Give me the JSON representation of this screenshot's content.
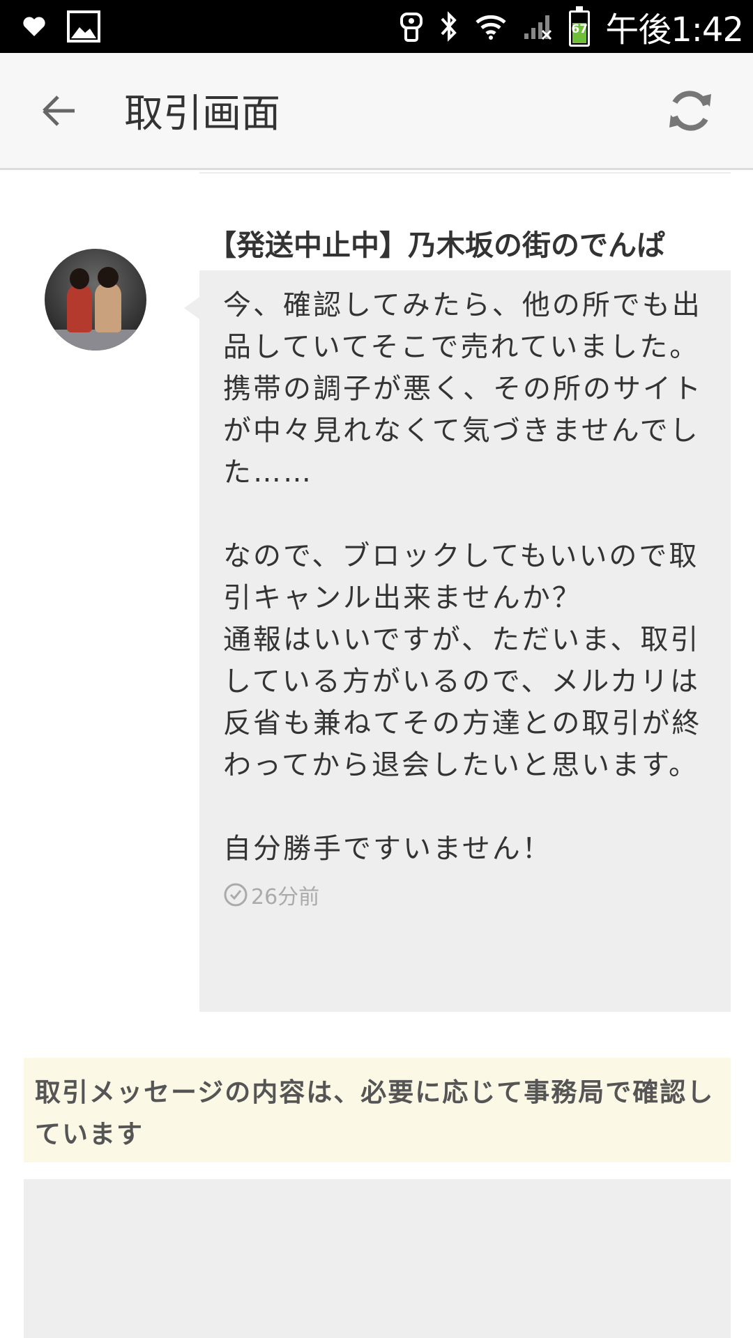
{
  "statusbar": {
    "time": "午後1:42",
    "battery_level": "67",
    "left_icons": [
      "heart-icon",
      "image-icon"
    ],
    "right_icons": [
      "nfc-icon",
      "bluetooth-icon",
      "wifi-icon",
      "signal-icon",
      "battery-icon"
    ]
  },
  "appbar": {
    "title": "取引画面",
    "back_icon": "arrow-left-icon",
    "refresh_icon": "refresh-icon"
  },
  "message": {
    "sender": "【発送中止中】乃木坂の街のでんぱ",
    "text": "今、確認してみたら、他の所でも出品していてそこで売れていました。\n携帯の調子が悪く、その所のサイトが中々見れなくて気づきませんでした……\n\nなので、ブロックしてもいいので取引キャンル出来ませんか？\n通報はいいですが、ただいま、取引している方がいるので、メルカリは反省も兼ねてその方達との取引が終わってから退会したいと思います。\n\n自分勝手ですいません！",
    "time_ago": "26分前"
  },
  "notice": {
    "text": "取引メッセージの内容は、必要に応じて事務局で確認しています"
  },
  "colors": {
    "bubble": "#eeeeee",
    "notice_bg": "#fbf8e6",
    "appbar_bg": "#f7f7f7"
  }
}
